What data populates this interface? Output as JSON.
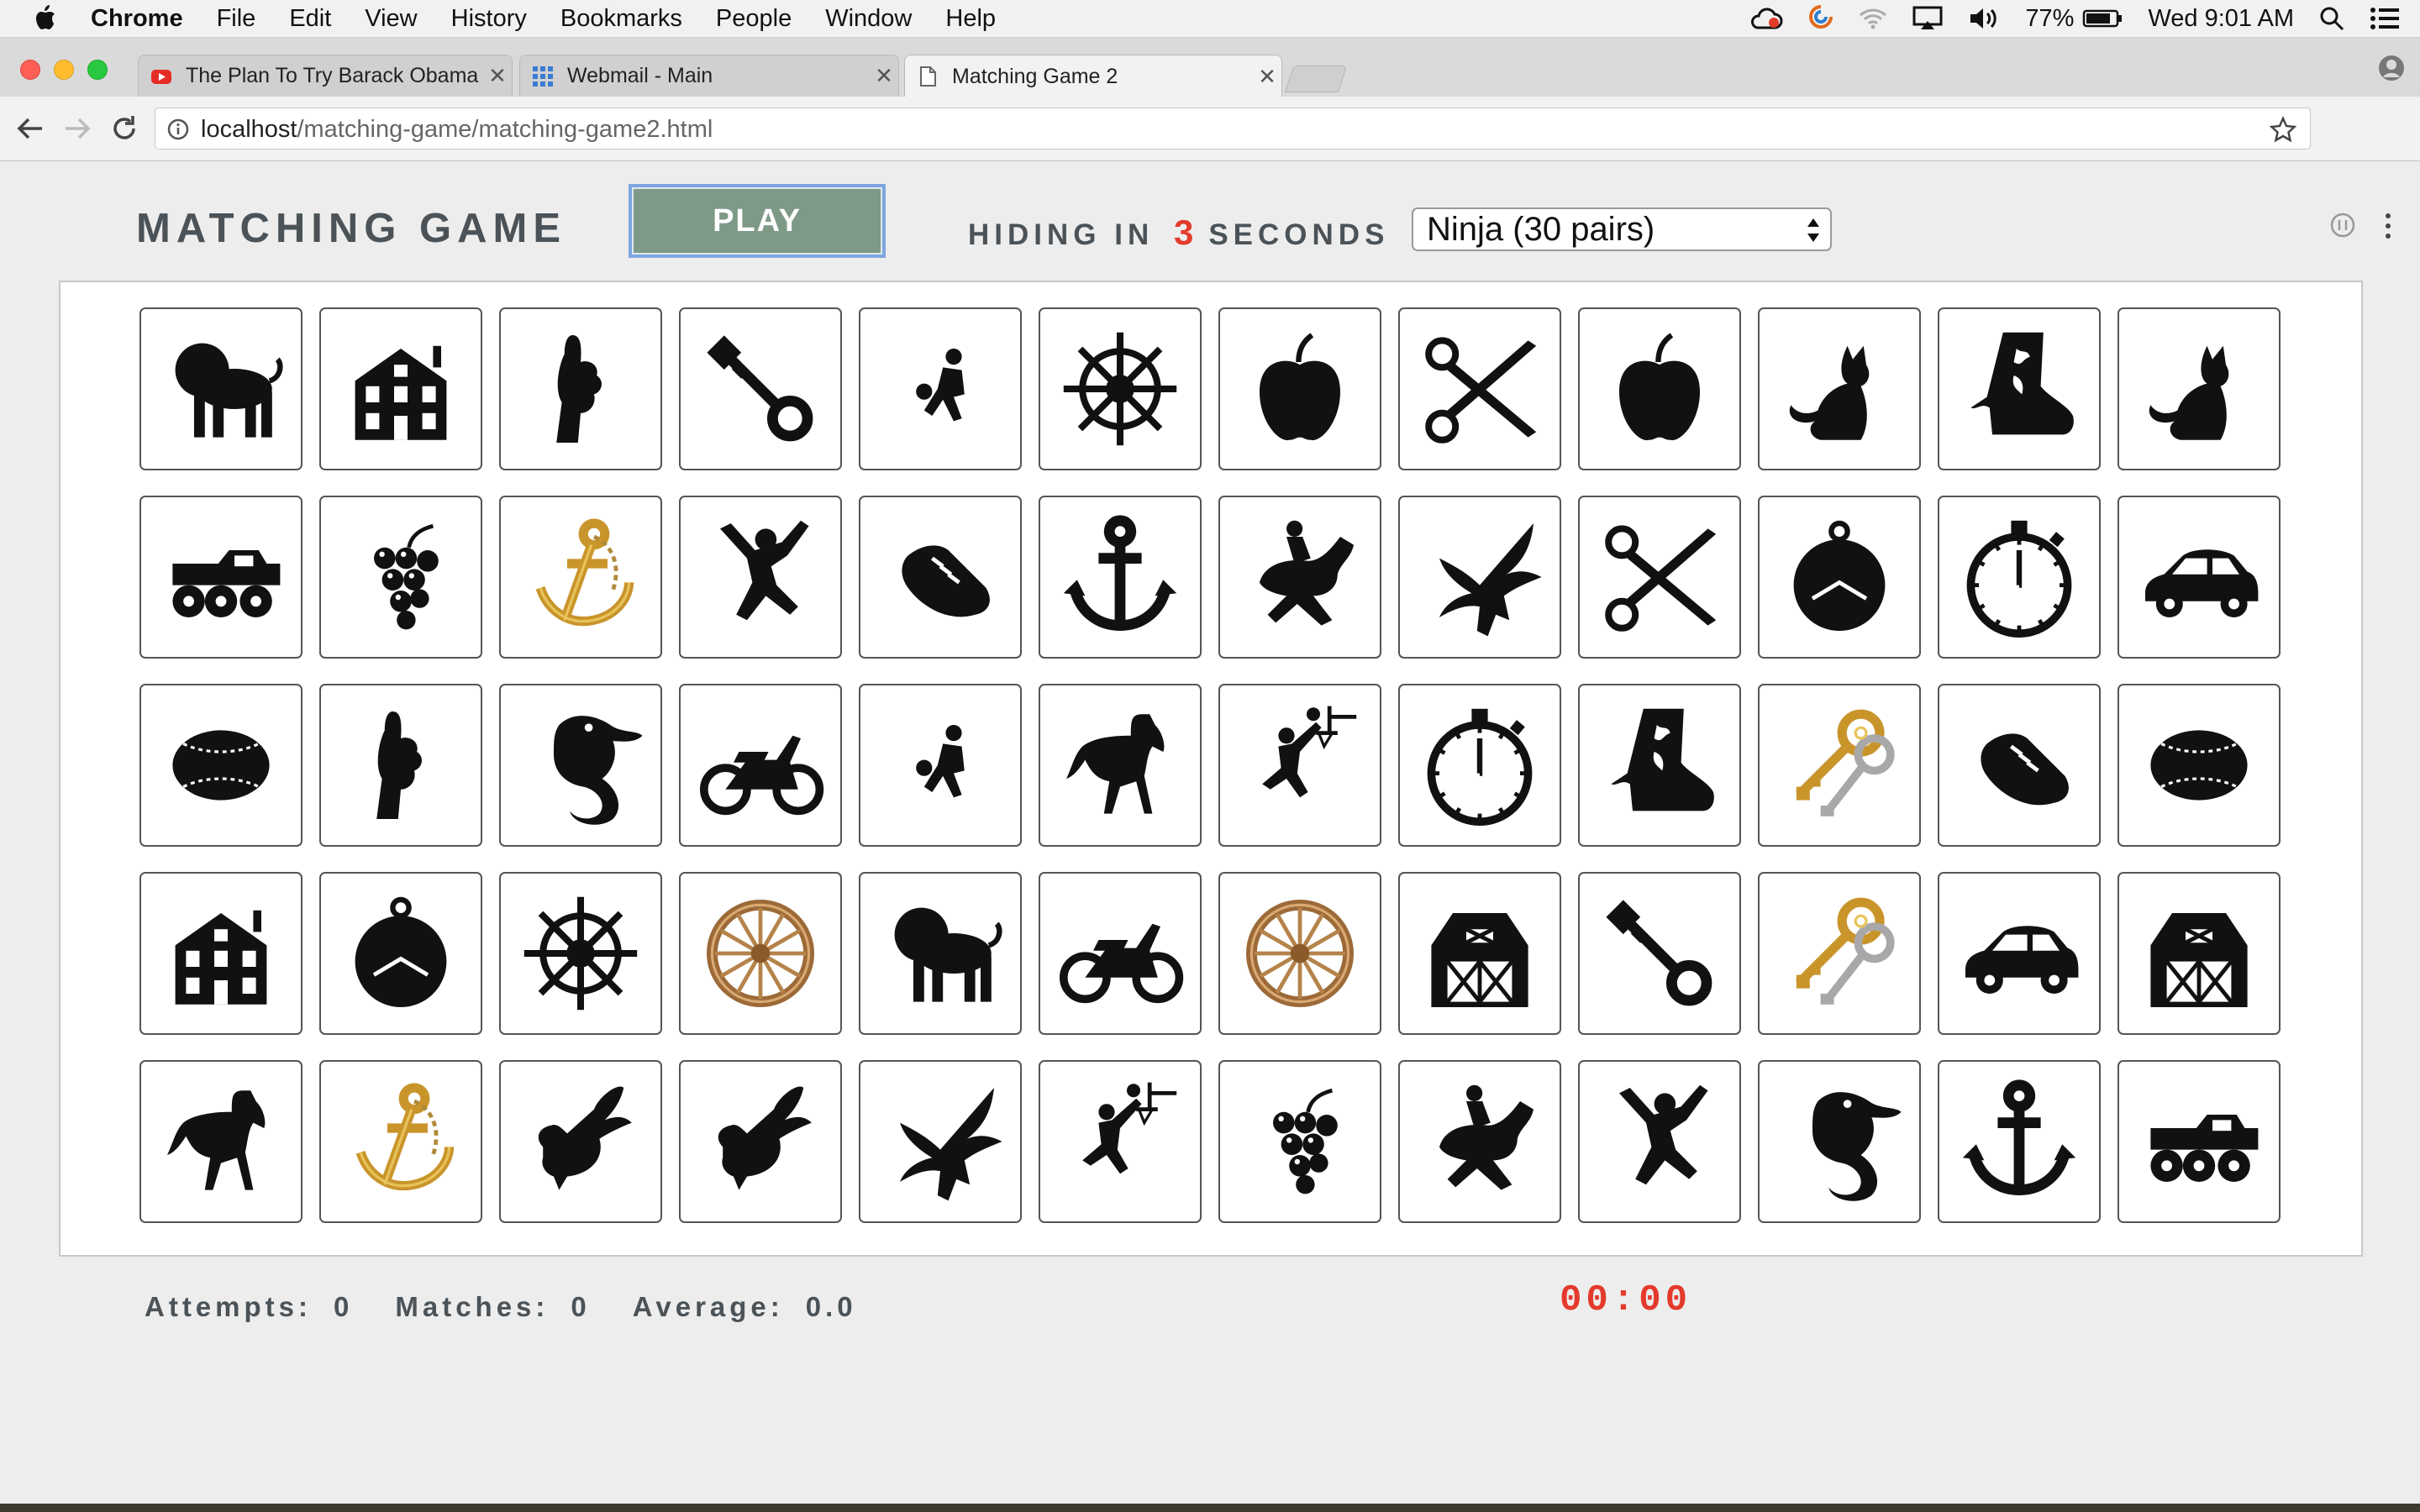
{
  "menubar": {
    "app": "Chrome",
    "items": [
      "File",
      "Edit",
      "View",
      "History",
      "Bookmarks",
      "People",
      "Window",
      "Help"
    ],
    "battery": "77%",
    "clock": "Wed 9:01 AM"
  },
  "tabs": [
    {
      "title": "The Plan To Try Barack Obama",
      "icon": "youtube-icon",
      "active": false
    },
    {
      "title": "Webmail - Main",
      "icon": "grid-app-icon",
      "active": false
    },
    {
      "title": "Matching Game 2",
      "icon": "page-icon",
      "active": true
    }
  ],
  "address": {
    "host": "localhost",
    "path": "/matching-game/matching-game2.html"
  },
  "game": {
    "title": "MATCHING GAME",
    "play_label": "PLAY",
    "hiding_prefix": "HIDING IN",
    "hiding_count": "3",
    "hiding_suffix": "SECONDS",
    "level": "Ninja (30 pairs)",
    "attempts_label": "Attempts:",
    "attempts": "0",
    "matches_label": "Matches:",
    "matches": "0",
    "average_label": "Average:",
    "average": "0.0",
    "timer": "00:00"
  },
  "cards": [
    "lion",
    "house",
    "hand",
    "key",
    "basketball-player",
    "ship-wheel",
    "apple",
    "scissors",
    "apple",
    "cat",
    "boot",
    "cat",
    "monster-truck",
    "grapes",
    "gold-anchor",
    "jumping-person",
    "sneaker",
    "anchor",
    "jockey",
    "eagle",
    "scissors",
    "pocket-watch",
    "stopwatch",
    "car",
    "baseball",
    "hand",
    "seahorse",
    "motorcycle",
    "basketball-player",
    "horse",
    "dunking-player",
    "stopwatch",
    "boot",
    "gold-keys",
    "sneaker",
    "baseball",
    "house",
    "pocket-watch",
    "ship-wheel",
    "wagon-wheel",
    "lion",
    "motorcycle",
    "wagon-wheel",
    "barn",
    "key",
    "gold-keys",
    "car",
    "barn",
    "horse",
    "gold-anchor",
    "duck",
    "duck",
    "eagle",
    "dunking-player",
    "grapes",
    "jockey",
    "jumping-person",
    "seahorse",
    "anchor",
    "monster-truck"
  ]
}
